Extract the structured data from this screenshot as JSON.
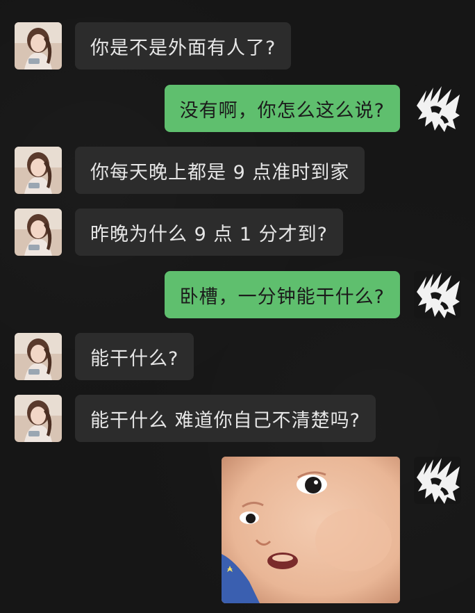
{
  "chat": {
    "messages": [
      {
        "side": "incoming",
        "type": "text",
        "text": "你是不是外面有人了?"
      },
      {
        "side": "outgoing",
        "type": "text",
        "text": "没有啊，你怎么这么说?"
      },
      {
        "side": "incoming",
        "type": "text",
        "text": "你每天晚上都是 9 点准时到家"
      },
      {
        "side": "incoming",
        "type": "text",
        "text": "昨晚为什么 9 点 1 分才到?"
      },
      {
        "side": "outgoing",
        "type": "text",
        "text": "卧槽，一分钟能干什么?"
      },
      {
        "side": "incoming",
        "type": "text",
        "text": "能干什么?"
      },
      {
        "side": "incoming",
        "type": "text",
        "text": "能干什么  难道你自己不清楚吗?"
      },
      {
        "side": "outgoing",
        "type": "sticker",
        "sticker": "surprised-baby-sticker"
      }
    ]
  },
  "colors": {
    "background": "#161616",
    "incoming_bubble": "#2c2c2c",
    "incoming_text": "#e6e6e6",
    "outgoing_bubble": "#5fbf6e",
    "outgoing_text": "#1b1b1b"
  }
}
